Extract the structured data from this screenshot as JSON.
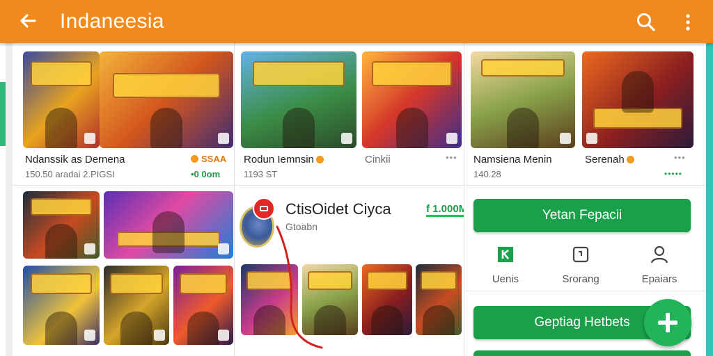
{
  "appbar": {
    "title": "Indaneesia",
    "back_icon": "arrow-left-icon",
    "search_icon": "search-icon",
    "more_icon": "more-vert-icon",
    "color": "#f08a1e"
  },
  "column1": {
    "items": [
      {
        "name": "Ndanssik as Dernena",
        "sub": "150.50 aradai 2.PIGSI",
        "price": "SSAA",
        "extra": "•0 0om"
      }
    ]
  },
  "column2": {
    "items": [
      {
        "name": "Rodun Iemnsin",
        "sub": "1193 ST"
      },
      {
        "name": "Cinkii",
        "extra": "•••"
      }
    ],
    "featured": {
      "title": "CtisOidet Ciyca",
      "sub": "Gtoabn",
      "price": "f 1.000M"
    }
  },
  "column3": {
    "items": [
      {
        "name": "Namsiena Menin",
        "sub": "140.28"
      },
      {
        "name": "Serenah",
        "extra": "•••"
      }
    ],
    "primary_button": "Yetan Fepacii",
    "nav": [
      {
        "label": "Uenis",
        "icon": "k-logo-icon"
      },
      {
        "label": "Srorang",
        "icon": "card-icon"
      },
      {
        "label": "Epaiars",
        "icon": "person-icon"
      }
    ],
    "secondary_button": "Geptiag Hetbets",
    "fab_icon": "plus-icon"
  },
  "colors": {
    "accent": "#f08a1e",
    "green": "#1aa04a",
    "fab": "#23b35a"
  }
}
